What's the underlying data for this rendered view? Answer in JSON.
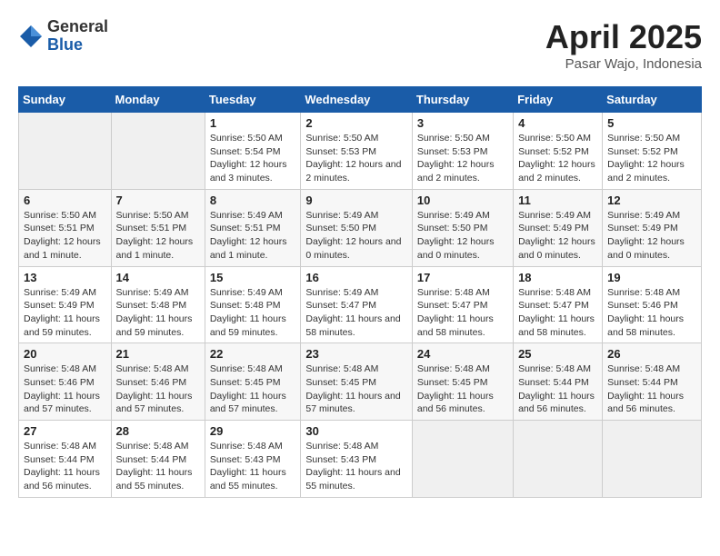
{
  "logo": {
    "general": "General",
    "blue": "Blue"
  },
  "header": {
    "month_year": "April 2025",
    "location": "Pasar Wajo, Indonesia"
  },
  "weekdays": [
    "Sunday",
    "Monday",
    "Tuesday",
    "Wednesday",
    "Thursday",
    "Friday",
    "Saturday"
  ],
  "weeks": [
    [
      {
        "day": "",
        "detail": ""
      },
      {
        "day": "",
        "detail": ""
      },
      {
        "day": "1",
        "detail": "Sunrise: 5:50 AM\nSunset: 5:54 PM\nDaylight: 12 hours and 3 minutes."
      },
      {
        "day": "2",
        "detail": "Sunrise: 5:50 AM\nSunset: 5:53 PM\nDaylight: 12 hours and 2 minutes."
      },
      {
        "day": "3",
        "detail": "Sunrise: 5:50 AM\nSunset: 5:53 PM\nDaylight: 12 hours and 2 minutes."
      },
      {
        "day": "4",
        "detail": "Sunrise: 5:50 AM\nSunset: 5:52 PM\nDaylight: 12 hours and 2 minutes."
      },
      {
        "day": "5",
        "detail": "Sunrise: 5:50 AM\nSunset: 5:52 PM\nDaylight: 12 hours and 2 minutes."
      }
    ],
    [
      {
        "day": "6",
        "detail": "Sunrise: 5:50 AM\nSunset: 5:51 PM\nDaylight: 12 hours and 1 minute."
      },
      {
        "day": "7",
        "detail": "Sunrise: 5:50 AM\nSunset: 5:51 PM\nDaylight: 12 hours and 1 minute."
      },
      {
        "day": "8",
        "detail": "Sunrise: 5:49 AM\nSunset: 5:51 PM\nDaylight: 12 hours and 1 minute."
      },
      {
        "day": "9",
        "detail": "Sunrise: 5:49 AM\nSunset: 5:50 PM\nDaylight: 12 hours and 0 minutes."
      },
      {
        "day": "10",
        "detail": "Sunrise: 5:49 AM\nSunset: 5:50 PM\nDaylight: 12 hours and 0 minutes."
      },
      {
        "day": "11",
        "detail": "Sunrise: 5:49 AM\nSunset: 5:49 PM\nDaylight: 12 hours and 0 minutes."
      },
      {
        "day": "12",
        "detail": "Sunrise: 5:49 AM\nSunset: 5:49 PM\nDaylight: 12 hours and 0 minutes."
      }
    ],
    [
      {
        "day": "13",
        "detail": "Sunrise: 5:49 AM\nSunset: 5:49 PM\nDaylight: 11 hours and 59 minutes."
      },
      {
        "day": "14",
        "detail": "Sunrise: 5:49 AM\nSunset: 5:48 PM\nDaylight: 11 hours and 59 minutes."
      },
      {
        "day": "15",
        "detail": "Sunrise: 5:49 AM\nSunset: 5:48 PM\nDaylight: 11 hours and 59 minutes."
      },
      {
        "day": "16",
        "detail": "Sunrise: 5:49 AM\nSunset: 5:47 PM\nDaylight: 11 hours and 58 minutes."
      },
      {
        "day": "17",
        "detail": "Sunrise: 5:48 AM\nSunset: 5:47 PM\nDaylight: 11 hours and 58 minutes."
      },
      {
        "day": "18",
        "detail": "Sunrise: 5:48 AM\nSunset: 5:47 PM\nDaylight: 11 hours and 58 minutes."
      },
      {
        "day": "19",
        "detail": "Sunrise: 5:48 AM\nSunset: 5:46 PM\nDaylight: 11 hours and 58 minutes."
      }
    ],
    [
      {
        "day": "20",
        "detail": "Sunrise: 5:48 AM\nSunset: 5:46 PM\nDaylight: 11 hours and 57 minutes."
      },
      {
        "day": "21",
        "detail": "Sunrise: 5:48 AM\nSunset: 5:46 PM\nDaylight: 11 hours and 57 minutes."
      },
      {
        "day": "22",
        "detail": "Sunrise: 5:48 AM\nSunset: 5:45 PM\nDaylight: 11 hours and 57 minutes."
      },
      {
        "day": "23",
        "detail": "Sunrise: 5:48 AM\nSunset: 5:45 PM\nDaylight: 11 hours and 57 minutes."
      },
      {
        "day": "24",
        "detail": "Sunrise: 5:48 AM\nSunset: 5:45 PM\nDaylight: 11 hours and 56 minutes."
      },
      {
        "day": "25",
        "detail": "Sunrise: 5:48 AM\nSunset: 5:44 PM\nDaylight: 11 hours and 56 minutes."
      },
      {
        "day": "26",
        "detail": "Sunrise: 5:48 AM\nSunset: 5:44 PM\nDaylight: 11 hours and 56 minutes."
      }
    ],
    [
      {
        "day": "27",
        "detail": "Sunrise: 5:48 AM\nSunset: 5:44 PM\nDaylight: 11 hours and 56 minutes."
      },
      {
        "day": "28",
        "detail": "Sunrise: 5:48 AM\nSunset: 5:44 PM\nDaylight: 11 hours and 55 minutes."
      },
      {
        "day": "29",
        "detail": "Sunrise: 5:48 AM\nSunset: 5:43 PM\nDaylight: 11 hours and 55 minutes."
      },
      {
        "day": "30",
        "detail": "Sunrise: 5:48 AM\nSunset: 5:43 PM\nDaylight: 11 hours and 55 minutes."
      },
      {
        "day": "",
        "detail": ""
      },
      {
        "day": "",
        "detail": ""
      },
      {
        "day": "",
        "detail": ""
      }
    ]
  ]
}
